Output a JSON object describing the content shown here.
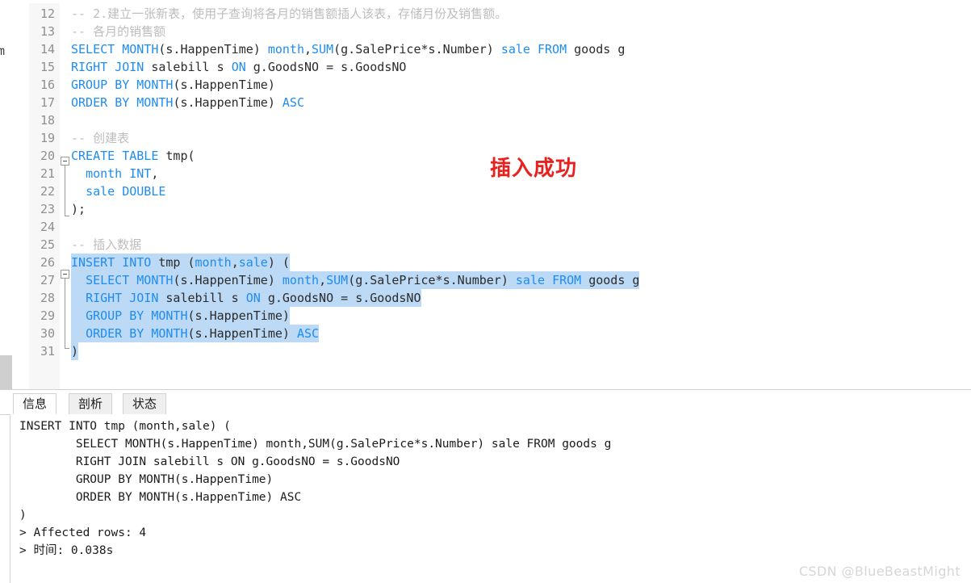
{
  "app": {
    "title": "SQL Editor"
  },
  "editor": {
    "annotation": "插入成功",
    "annotation_color": "#e8201e",
    "selection_color": "#bcd9f5",
    "keyword_color": "#1f8cf0",
    "comment_color": "#bdbdbd",
    "left_partial_text": "m",
    "lines": [
      {
        "num": "12",
        "text": "-- 2.建立一张新表，使用子查询将各月的销售额插人该表，存储月份及销售额。"
      },
      {
        "num": "13",
        "text": "-- 各月的销售额"
      },
      {
        "num": "14",
        "text": "SELECT MONTH(s.HappenTime) month,SUM(g.SalePrice*s.Number) sale FROM goods g"
      },
      {
        "num": "15",
        "text": "RIGHT JOIN salebill s ON g.GoodsNO = s.GoodsNO"
      },
      {
        "num": "16",
        "text": "GROUP BY MONTH(s.HappenTime)"
      },
      {
        "num": "17",
        "text": "ORDER BY MONTH(s.HappenTime) ASC"
      },
      {
        "num": "18",
        "text": ""
      },
      {
        "num": "19",
        "text": "-- 创建表"
      },
      {
        "num": "20",
        "text": "CREATE TABLE tmp("
      },
      {
        "num": "21",
        "text": "  month INT,"
      },
      {
        "num": "22",
        "text": "  sale DOUBLE"
      },
      {
        "num": "23",
        "text": ");"
      },
      {
        "num": "24",
        "text": ""
      },
      {
        "num": "25",
        "text": "-- 插入数据"
      },
      {
        "num": "26",
        "text": "INSERT INTO tmp (month,sale) ("
      },
      {
        "num": "27",
        "text": "  SELECT MONTH(s.HappenTime) month,SUM(g.SalePrice*s.Number) sale FROM goods g"
      },
      {
        "num": "28",
        "text": "  RIGHT JOIN salebill s ON g.GoodsNO = s.GoodsNO"
      },
      {
        "num": "29",
        "text": "  GROUP BY MONTH(s.HappenTime)"
      },
      {
        "num": "30",
        "text": "  ORDER BY MONTH(s.HappenTime) ASC"
      },
      {
        "num": "31",
        "text": ")"
      }
    ]
  },
  "result_panel": {
    "tabs": [
      {
        "label": "信息",
        "active": true
      },
      {
        "label": "剖析",
        "active": false
      },
      {
        "label": "状态",
        "active": false
      }
    ],
    "output": [
      "INSERT INTO tmp (month,sale) (",
      "        SELECT MONTH(s.HappenTime) month,SUM(g.SalePrice*s.Number) sale FROM goods g",
      "        RIGHT JOIN salebill s ON g.GoodsNO = s.GoodsNO",
      "        GROUP BY MONTH(s.HappenTime)",
      "        ORDER BY MONTH(s.HappenTime) ASC",
      ")",
      "> Affected rows: 4",
      "> 时间: 0.038s"
    ]
  },
  "watermark": {
    "text": "CSDN @BlueBeastMight"
  }
}
